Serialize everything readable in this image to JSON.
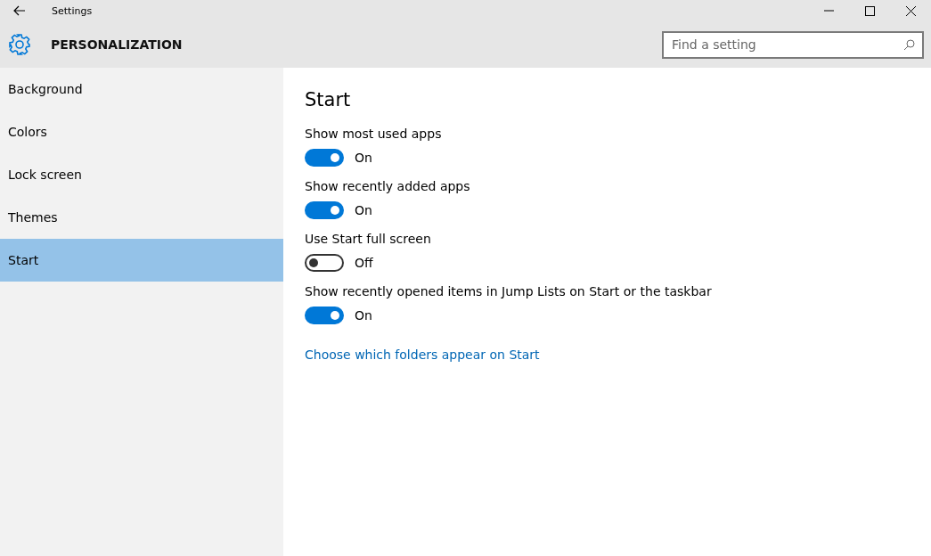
{
  "window": {
    "title": "Settings"
  },
  "header": {
    "title": "PERSONALIZATION",
    "search": {
      "placeholder": "Find a setting"
    }
  },
  "sidebar": {
    "items": [
      {
        "label": "Background",
        "selected": false
      },
      {
        "label": "Colors",
        "selected": false
      },
      {
        "label": "Lock screen",
        "selected": false
      },
      {
        "label": "Themes",
        "selected": false
      },
      {
        "label": "Start",
        "selected": true
      }
    ]
  },
  "content": {
    "title": "Start",
    "settings": [
      {
        "label": "Show most used apps",
        "on": true,
        "state": "On"
      },
      {
        "label": "Show recently added apps",
        "on": true,
        "state": "On"
      },
      {
        "label": "Use Start full screen",
        "on": false,
        "state": "Off"
      },
      {
        "label": "Show recently opened items in Jump Lists on Start or the taskbar",
        "on": true,
        "state": "On"
      }
    ],
    "link": "Choose which folders appear on Start"
  }
}
